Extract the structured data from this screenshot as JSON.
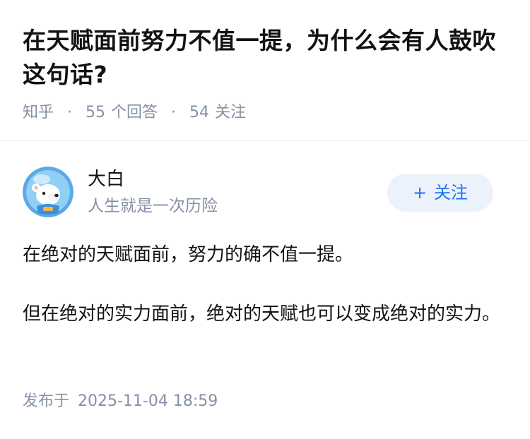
{
  "question": {
    "title": "在天赋面前努力不值一提，为什么会有人鼓吹这句话?",
    "source": "知乎",
    "answer_count": "55",
    "answer_label": "个回答",
    "follow_count": "54",
    "follow_label": "关注"
  },
  "author": {
    "name": "大白",
    "bio": "人生就是一次历险",
    "avatar_icon": "polar-bear-astronaut-avatar",
    "follow_button_plus": "+",
    "follow_button_label": "关注"
  },
  "answer": {
    "paragraphs": [
      "在绝对的天赋面前，努力的确不值一提。",
      "但在绝对的实力面前，绝对的天赋也可以变成绝对的实力。"
    ],
    "publish_label": "发布于",
    "publish_time": "2025-11-04 18:59"
  },
  "colors": {
    "title": "#121212",
    "meta": "#8590a6",
    "accent": "#1772f6",
    "button_bg": "#ebf2fb",
    "divider": "#ebebeb"
  }
}
